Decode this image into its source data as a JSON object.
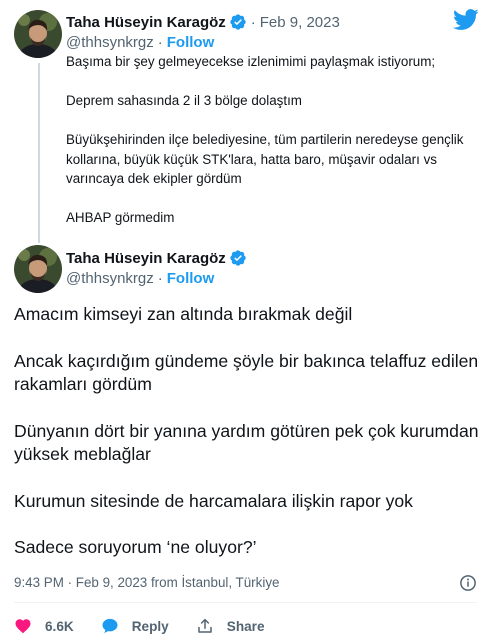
{
  "colors": {
    "accent": "#1d9bf0",
    "heart": "#f91880",
    "muted": "#536471",
    "text": "#0f1419"
  },
  "brand_icon": "twitter-bird-icon",
  "first_tweet": {
    "author_name": "Taha Hüseyin Karagöz",
    "separator": "·",
    "date": "Feb 9, 2023",
    "handle": "@thhsynkrgz",
    "handle_separator": "·",
    "follow_label": "Follow",
    "paragraphs": [
      "Başıma bir şey gelmeyecekse izlenimimi paylaşmak istiyorum;",
      "Deprem sahasında 2 il 3 bölge dolaştım",
      "Büyükşehirinden ilçe belediyesine, tüm partilerin neredeyse gençlik kollarına, büyük küçük STK'lara, hatta baro, müşavir odaları vs varıncaya dek ekipler gördüm",
      "AHBAP görmedim"
    ]
  },
  "main_tweet": {
    "author_name": "Taha Hüseyin Karagöz",
    "handle": "@thhsynkrgz",
    "handle_separator": "·",
    "follow_label": "Follow",
    "paragraphs": [
      "Amacım kimseyi zan altında bırakmak değil",
      "Ancak kaçırdığım gündeme şöyle bir bakınca telaffuz edilen rakamları gördüm",
      "Dünyanın dört bir yanına yardım götüren pek çok kurumdan yüksek meblağlar",
      "Kurumun sitesinde de harcamalara ilişkin rapor yok",
      "Sadece soruyorum ‘ne oluyor?’"
    ],
    "timestamp": "9:43 PM · Feb 9, 2023 from İstanbul, Türkiye",
    "likes": "6.6K",
    "reply_label": "Reply",
    "share_label": "Share"
  }
}
